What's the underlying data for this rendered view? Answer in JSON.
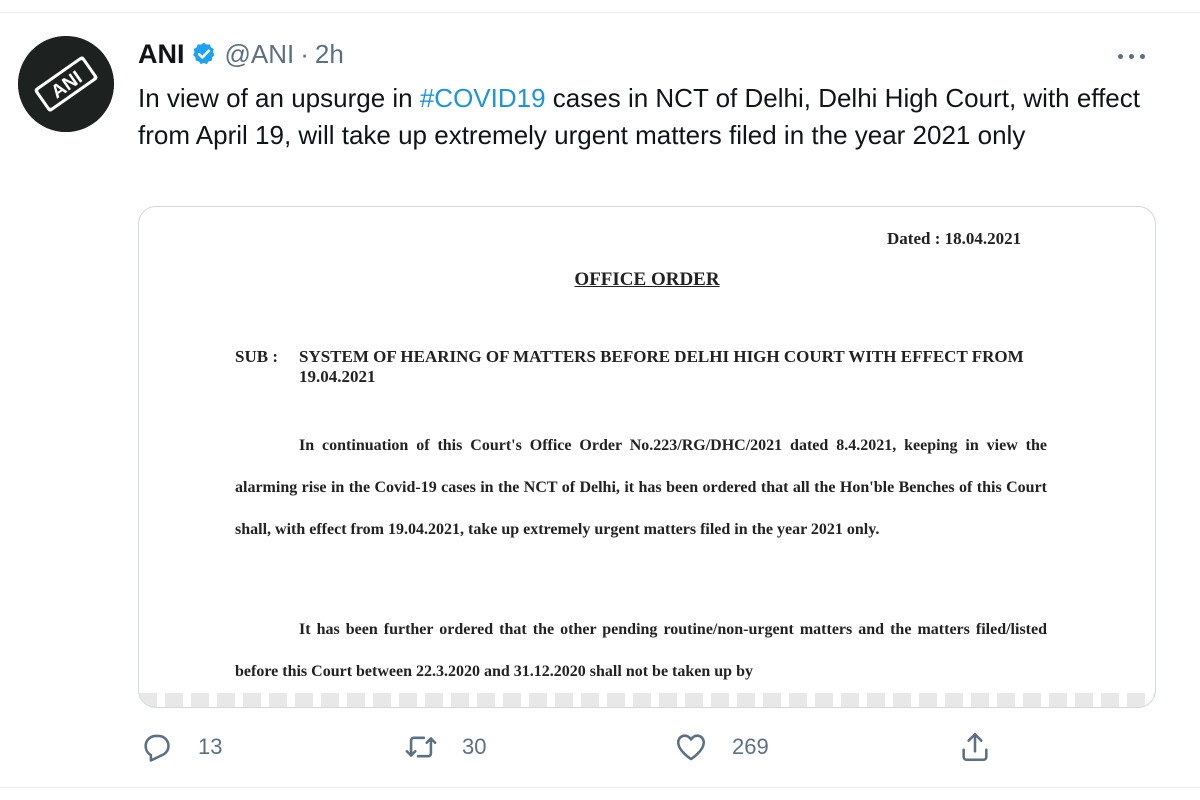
{
  "author": {
    "display_name": "ANI",
    "handle": "@ANI",
    "separator": "·",
    "time": "2h",
    "avatar_text": "ANI",
    "verified": true,
    "verified_color": "#1da1f2"
  },
  "tweet": {
    "text_before": "In view of an upsurge in ",
    "hashtag": "#COVID19",
    "text_after": " cases in NCT of Delhi, Delhi High Court, with effect from April 19, will take up extremely urgent matters filed in the year 2021 only",
    "hashtag_color": "#1b95e0"
  },
  "document": {
    "dated": "Dated : 18.04.2021",
    "title": "OFFICE ORDER",
    "sub_label": "SUB :",
    "sub_text": "SYSTEM OF HEARING OF MATTERS BEFORE DELHI HIGH COURT WITH EFFECT FROM 19.04.2021",
    "para1": "In continuation of this Court's Office Order No.223/RG/DHC/2021 dated 8.4.2021, keeping in view the alarming rise in the Covid-19 cases in the NCT of Delhi, it has been ordered that all the Hon'ble Benches of this Court shall, with effect from 19.04.2021, take up extremely urgent matters filed in the year 2021 only.",
    "para2": "It has been further ordered that the other pending routine/non-urgent matters and the matters filed/listed before this Court between 22.3.2020 and 31.12.2020 shall not be taken up by"
  },
  "actions": {
    "reply_count": "13",
    "retweet_count": "30",
    "like_count": "269",
    "icon_color": "#5b7083"
  },
  "icons": [
    "avatar-logo",
    "verified-badge-icon",
    "more-options-icon",
    "reply-icon",
    "retweet-icon",
    "like-icon",
    "share-icon"
  ]
}
